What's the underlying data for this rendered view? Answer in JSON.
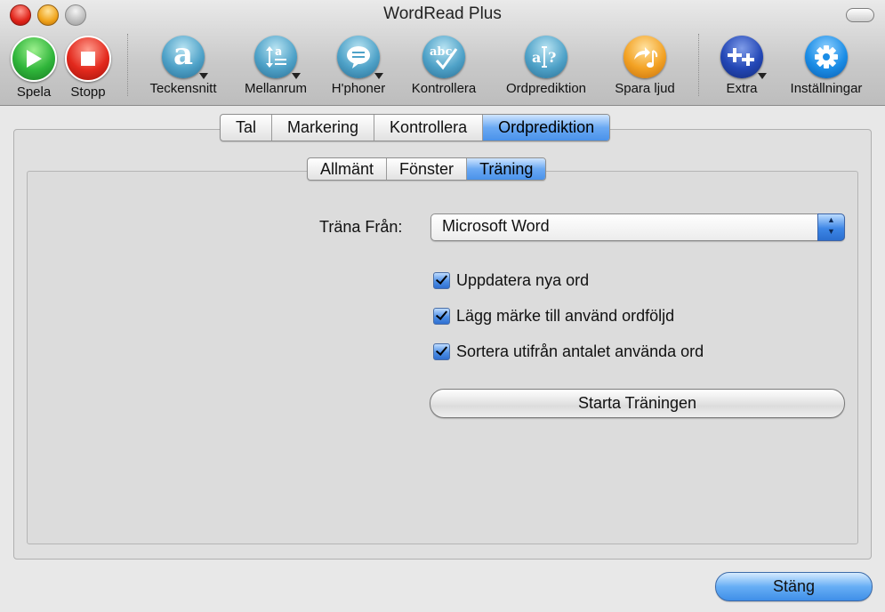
{
  "window": {
    "title": "WordRead Plus"
  },
  "toolbar": {
    "items": [
      {
        "id": "play",
        "label": "Spela",
        "icon": "play-icon"
      },
      {
        "id": "stop",
        "label": "Stopp",
        "icon": "stop-icon"
      },
      {
        "id": "font",
        "label": "Teckensnitt",
        "icon": "font-icon"
      },
      {
        "id": "spacing",
        "label": "Mellanrum",
        "icon": "spacing-icon"
      },
      {
        "id": "headphones",
        "label": "H'phoner",
        "icon": "speech-bubble-icon"
      },
      {
        "id": "check",
        "label": "Kontrollera",
        "icon": "spellcheck-icon"
      },
      {
        "id": "prediction",
        "label": "Ordprediktion",
        "icon": "word-prediction-icon"
      },
      {
        "id": "saveaudio",
        "label": "Spara ljud",
        "icon": "save-audio-icon"
      },
      {
        "id": "extra",
        "label": "Extra",
        "icon": "plus-icon"
      },
      {
        "id": "settings",
        "label": "Inställningar",
        "icon": "gear-icon"
      }
    ]
  },
  "tabs": [
    "Tal",
    "Markering",
    "Kontrollera",
    "Ordprediktion"
  ],
  "subtabs": [
    "Allmänt",
    "Fönster",
    "Träning"
  ],
  "form": {
    "train_from_label": "Träna Från:",
    "train_from_value": "Microsoft Word",
    "checkboxes": [
      {
        "label": "Uppdatera nya ord",
        "checked": true
      },
      {
        "label": "Lägg märke till använd ordföljd",
        "checked": true
      },
      {
        "label": "Sortera utifrån antalet använda ord",
        "checked": true
      }
    ],
    "start_button": "Starta Träningen"
  },
  "footer": {
    "close_button": "Stäng"
  }
}
